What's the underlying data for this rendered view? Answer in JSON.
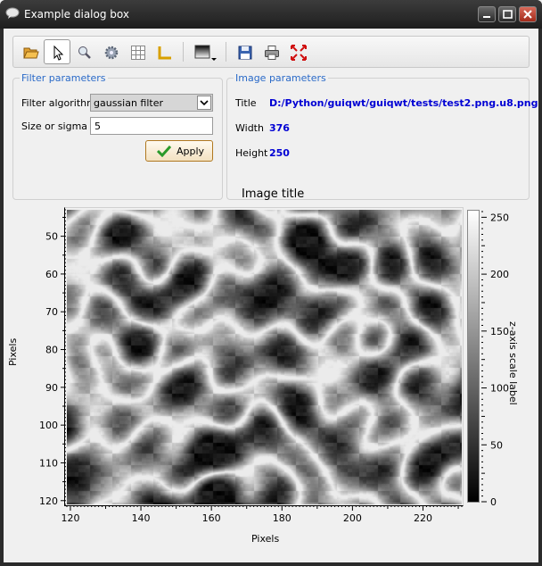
{
  "window": {
    "title": "Example dialog box"
  },
  "toolbar": {
    "tools": [
      {
        "name": "open-folder-icon"
      },
      {
        "name": "select-pointer-icon",
        "active": true
      },
      {
        "name": "zoom-magnifier-icon"
      },
      {
        "name": "gear-icon"
      },
      {
        "name": "grid-icon"
      },
      {
        "name": "axes-corner-icon"
      },
      {
        "name": "colormap-icon"
      },
      {
        "name": "save-icon"
      },
      {
        "name": "print-icon"
      },
      {
        "name": "full-range-icon"
      }
    ]
  },
  "filter_parameters": {
    "group_title": "Filter parameters",
    "algorithm_label": "Filter algorithm",
    "algorithm_value": "gaussian filter",
    "sigma_label": "Size or sigma",
    "sigma_value": "5",
    "apply_label": "Apply"
  },
  "image_parameters": {
    "group_title": "Image parameters",
    "title_label": "Title",
    "title_value": "D:/Python/guiqwt/guiqwt/tests/test2.png.u8.png",
    "width_label": "Width",
    "width_value": "376",
    "height_label": "Height",
    "height_value": "250"
  },
  "plot": {
    "title": "Image title",
    "xlabel": "Pixels",
    "ylabel": "Pixels",
    "zlabel": "z-axis scale label",
    "x_ticks": [
      "120",
      "140",
      "160",
      "180",
      "200",
      "220"
    ],
    "y_ticks": [
      "50",
      "60",
      "70",
      "80",
      "90",
      "100",
      "110",
      "120"
    ],
    "z_ticks": [
      "250",
      "200",
      "150",
      "100",
      "50",
      "0"
    ]
  },
  "chart_data": {
    "type": "heatmap",
    "title": "Image title",
    "xlabel": "Pixels",
    "ylabel": "Pixels",
    "zlabel": "z-axis scale label",
    "xlim": [
      119,
      231
    ],
    "ylim": [
      43,
      121
    ],
    "zlim": [
      0,
      255
    ],
    "colormap": "gray"
  },
  "colors": {
    "group_title": "#2a6ac8",
    "value_text": "#0000d4"
  }
}
